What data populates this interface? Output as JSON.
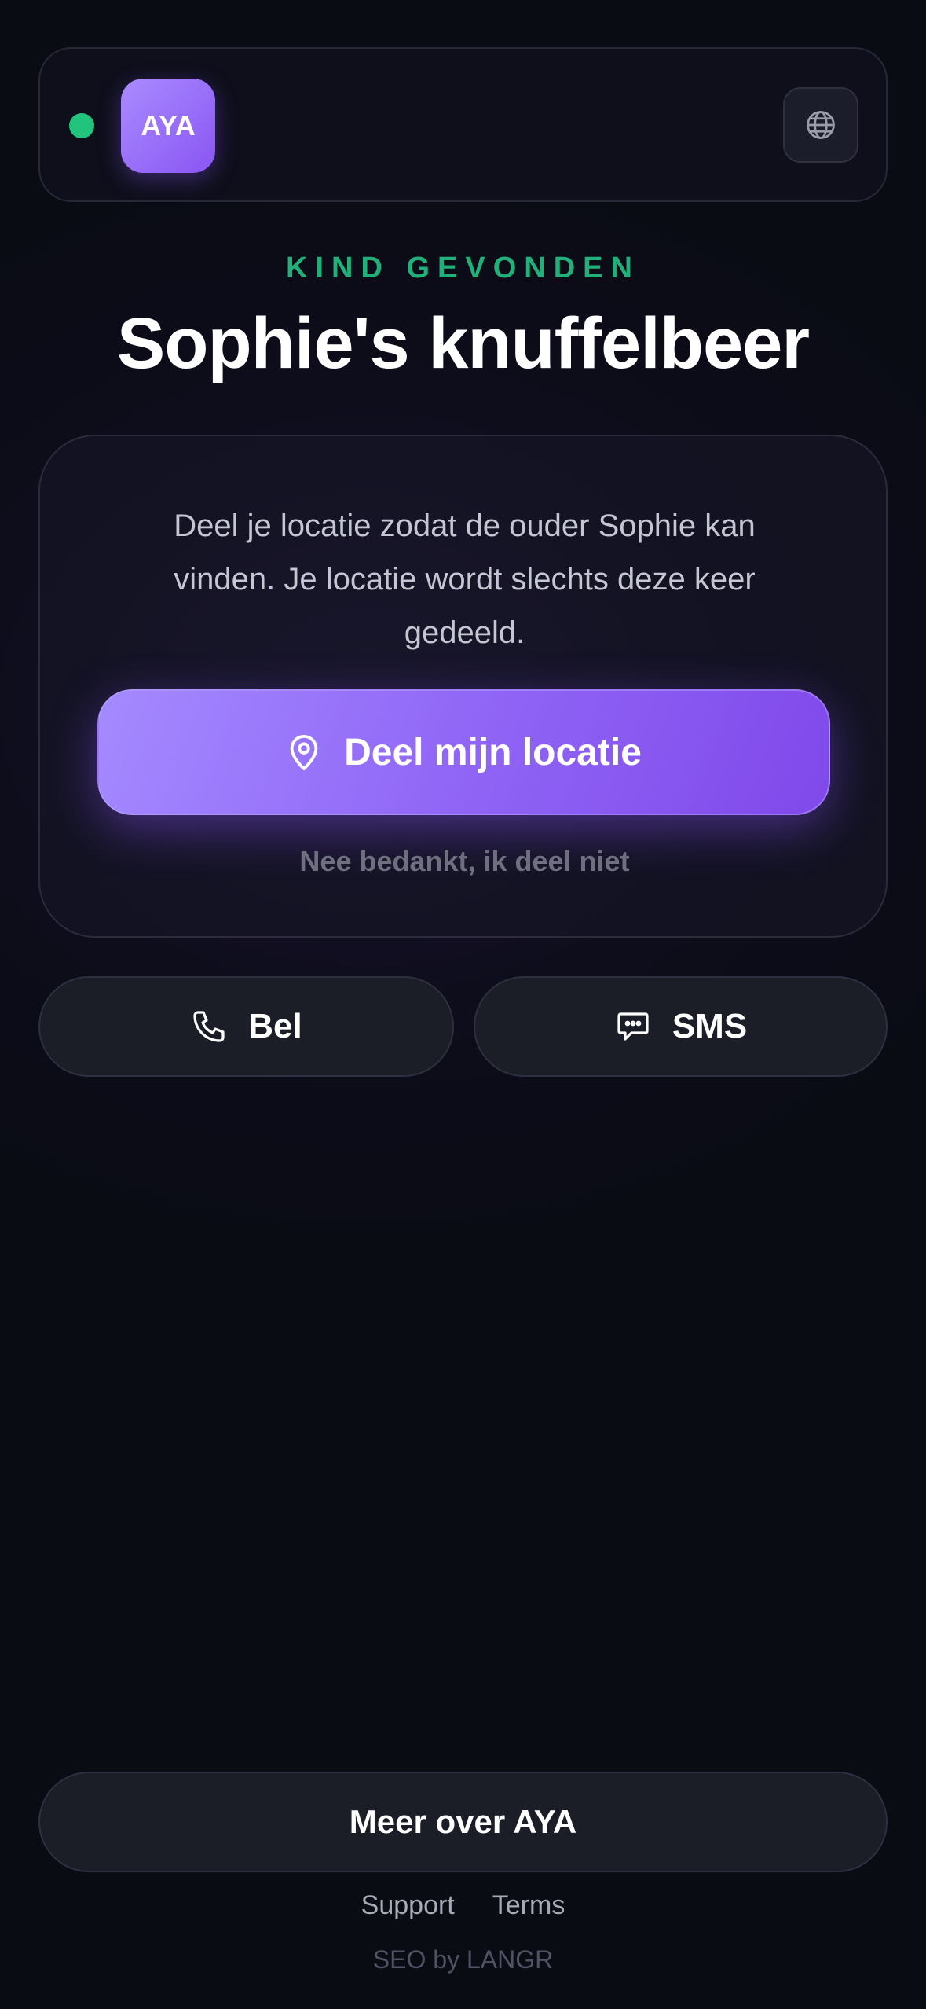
{
  "header": {
    "logo_text": "AYA",
    "status_color": "#22c37d",
    "language_icon": "globe-icon"
  },
  "hero": {
    "eyebrow": "KIND GEVONDEN",
    "title": "Sophie's knuffelbeer"
  },
  "card": {
    "message": "Deel je locatie zodat de ouder Sophie kan vinden. Je locatie wordt slechts deze keer gedeeld.",
    "share_label": "Deel mijn locatie",
    "share_icon": "location-pin-icon",
    "decline_label": "Nee bedankt, ik deel niet"
  },
  "actions": {
    "call_label": "Bel",
    "call_icon": "phone-icon",
    "sms_label": "SMS",
    "sms_icon": "chat-bubble-icon"
  },
  "footer": {
    "more_label": "Meer over AYA",
    "links": [
      "Support",
      "Terms"
    ],
    "credit": "SEO by LANGR"
  },
  "colors": {
    "accent": "#8a55f3",
    "success": "#22b07a",
    "background": "#0e0d1c"
  }
}
